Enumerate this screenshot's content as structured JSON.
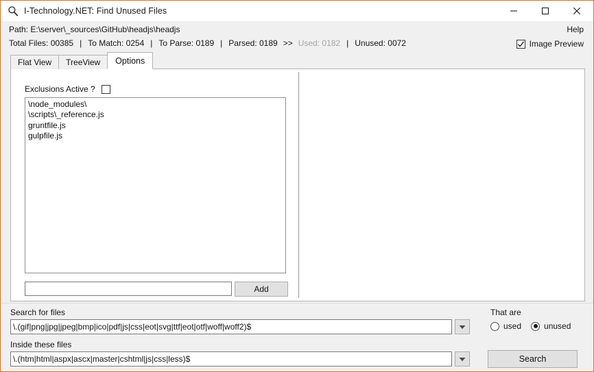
{
  "window": {
    "title": "I-Technology.NET: Find Unused Files",
    "icon": "magnifier-icon",
    "border_color": "#d8711f",
    "controls": {
      "minimize": "minimize-icon",
      "maximize": "maximize-icon",
      "close": "close-icon"
    }
  },
  "header": {
    "path_line": "Path: E:\\server\\_sources\\GitHub\\headjs\\headjs",
    "help_label": "Help",
    "image_preview": {
      "label": "Image Preview",
      "checked": true
    },
    "stats": {
      "total_files_label": "Total Files:",
      "total_files_value": "00385",
      "to_match_label": "To Match:",
      "to_match_value": "0254",
      "to_parse_label": "To Parse:",
      "to_parse_value": "0189",
      "parsed_label": "Parsed:",
      "parsed_value": "0189",
      "arrow": ">>",
      "used_label": "Used:",
      "used_value": "0182",
      "used_dimmed": true,
      "unused_label": "Unused:",
      "unused_value": "0072",
      "separator": "|",
      "full_line": "Total Files: 00385  |  To Match: 0254  |  To Parse: 0189  |  Parsed: 0189  >>  Used: 0182  |  Unused: 0072"
    }
  },
  "tabs": [
    {
      "label": "Flat View",
      "active": false
    },
    {
      "label": "TreeView",
      "active": false
    },
    {
      "label": "Options",
      "active": true
    }
  ],
  "options_tab": {
    "exclusions_label": "Exclusions Active ?",
    "exclusions_checked": false,
    "exclusions": [
      "\\node_modules\\",
      "\\scripts\\_reference.js",
      "gruntfile.js",
      "gulpfile.js"
    ],
    "add_input_value": "",
    "add_input_placeholder": "",
    "add_button_label": "Add"
  },
  "bottom": {
    "search_for_files_label": "Search for files",
    "search_for_files_value": "\\.(gif|png|jpg|jpeg|bmp|ico|pdf|js|css|eot|svg|ttf|eot|otf|woff|woff2)$",
    "inside_these_files_label": "Inside these files",
    "inside_these_files_value": "\\.(htm|html|aspx|ascx|master|cshtml|js|css|less)$",
    "dropdown_icon": "chevron-down-icon",
    "that_are_label": "That are",
    "radio_used_label": "used",
    "radio_unused_label": "unused",
    "radio_selected": "unused",
    "search_button_label": "Search"
  },
  "colors": {
    "window_border": "#d8711f",
    "chrome_bg": "#f0f0f0",
    "panel_bg": "#ffffff",
    "button_bg": "#e1e1e1",
    "button_border": "#adadad",
    "dim_text": "#a6a6a6",
    "text": "#141414"
  }
}
